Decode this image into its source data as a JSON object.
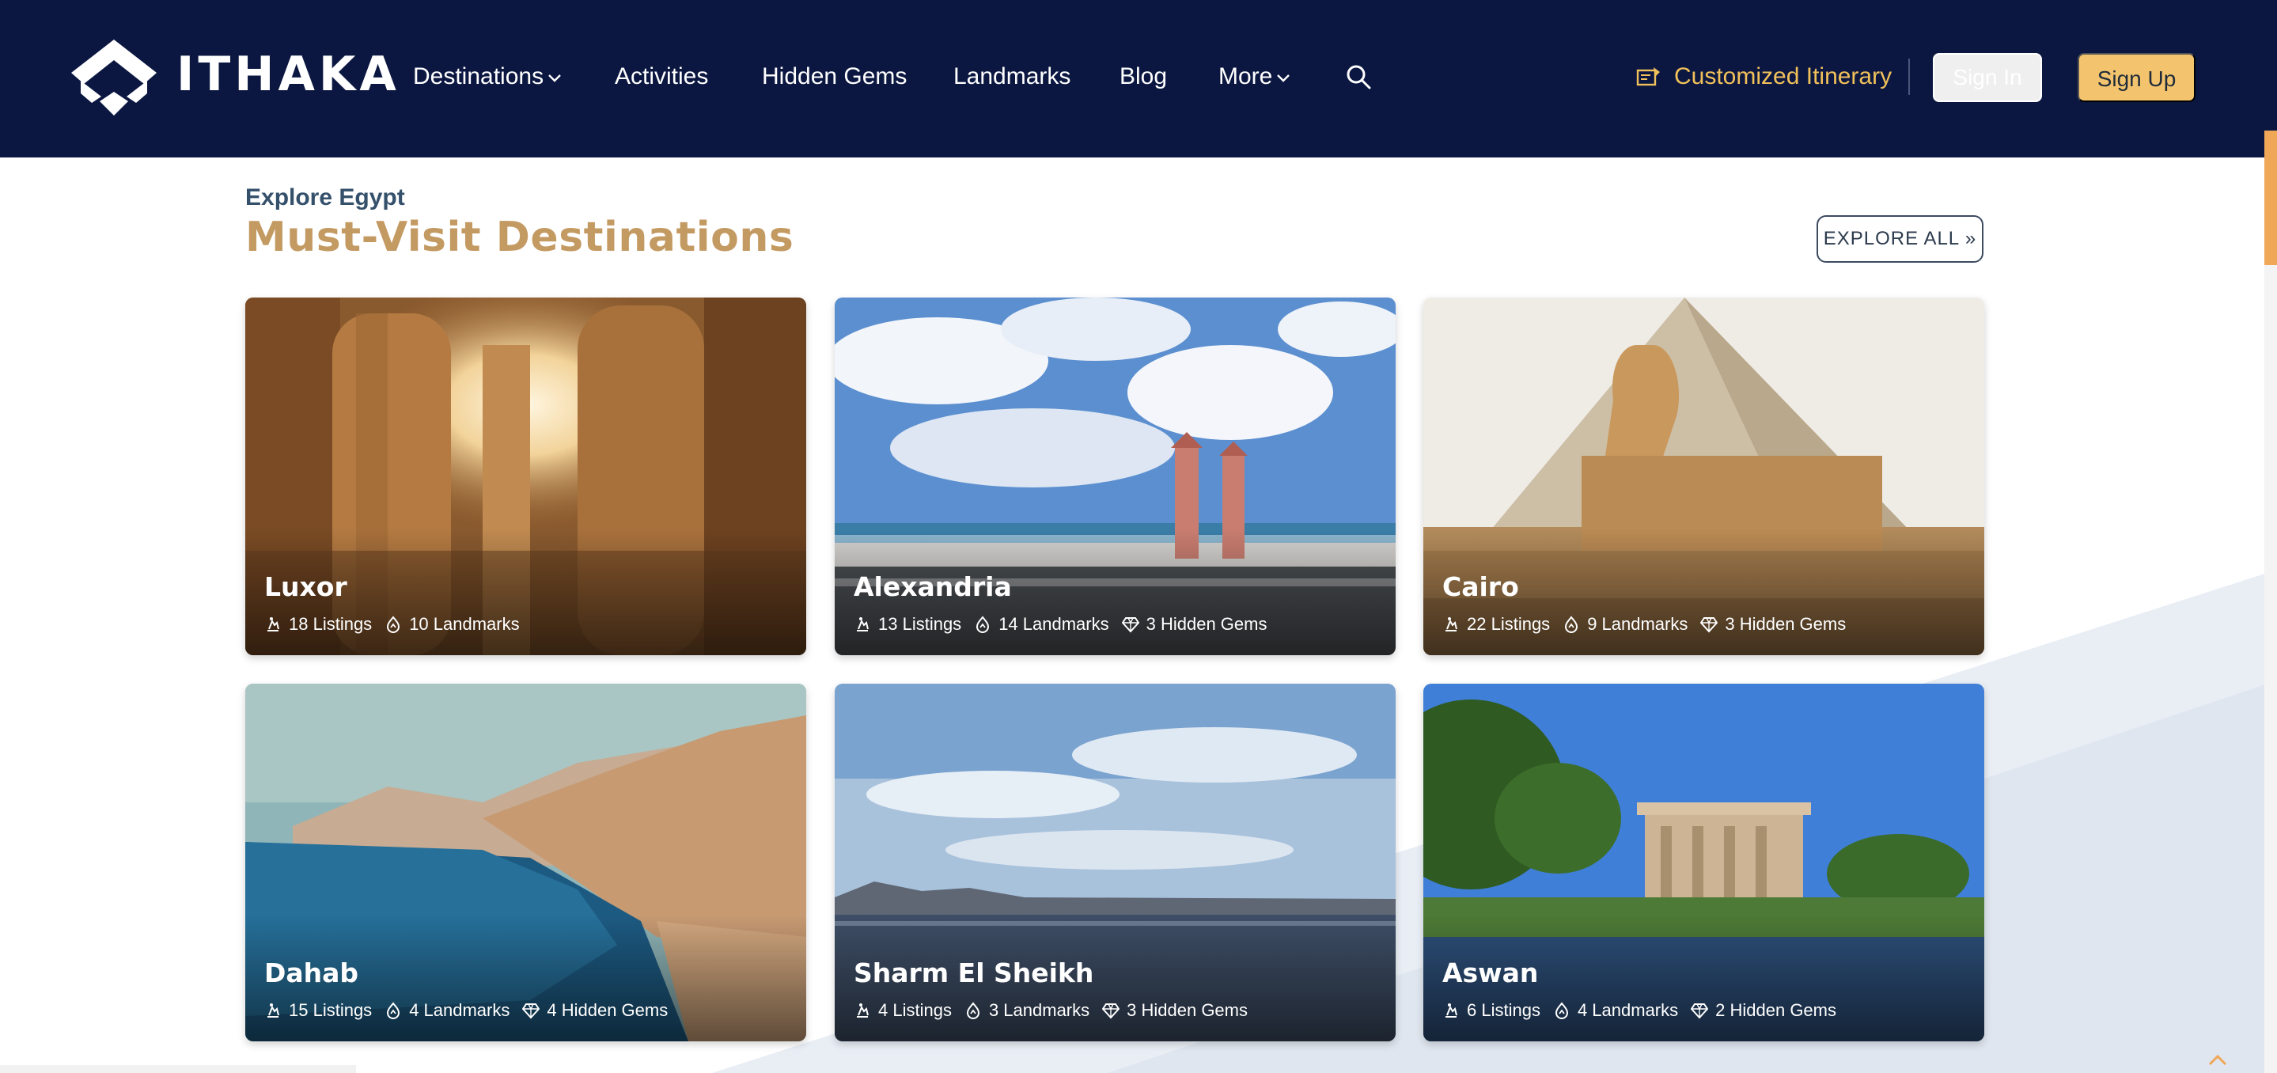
{
  "brand": {
    "name": "ITHAKA"
  },
  "nav": {
    "items": [
      {
        "label": "Destinations",
        "has_dropdown": true
      },
      {
        "label": "Activities",
        "has_dropdown": false
      },
      {
        "label": "Hidden Gems",
        "has_dropdown": false
      },
      {
        "label": "Landmarks",
        "has_dropdown": false
      },
      {
        "label": "Blog",
        "has_dropdown": false
      },
      {
        "label": "More",
        "has_dropdown": true
      }
    ],
    "search_icon": "search-icon",
    "customized_itinerary": "Customized Itinerary",
    "sign_in": "Sign In",
    "sign_up": "Sign Up"
  },
  "section": {
    "kicker": "Explore Egypt",
    "title": "Must-Visit Destinations",
    "explore_all": "EXPLORE ALL »"
  },
  "destinations": [
    {
      "name": "Luxor",
      "listings": "18 Listings",
      "landmarks": "10 Landmarks",
      "hidden_gems": ""
    },
    {
      "name": "Alexandria",
      "listings": "13 Listings",
      "landmarks": "14 Landmarks",
      "hidden_gems": "3 Hidden Gems"
    },
    {
      "name": "Cairo",
      "listings": "22 Listings",
      "landmarks": "9 Landmarks",
      "hidden_gems": "3 Hidden Gems"
    },
    {
      "name": "Dahab",
      "listings": "15 Listings",
      "landmarks": "4 Landmarks",
      "hidden_gems": "4 Hidden Gems"
    },
    {
      "name": "Sharm El Sheikh",
      "listings": "4 Listings",
      "landmarks": "3 Landmarks",
      "hidden_gems": "3 Hidden Gems"
    },
    {
      "name": "Aswan",
      "listings": "6 Listings",
      "landmarks": "4 Landmarks",
      "hidden_gems": "2 Hidden Gems"
    }
  ],
  "colors": {
    "header_bg": "#0b1741",
    "accent_gold": "#f3c46d",
    "title_tan": "#c49a63",
    "kicker_slate": "#34506b"
  }
}
